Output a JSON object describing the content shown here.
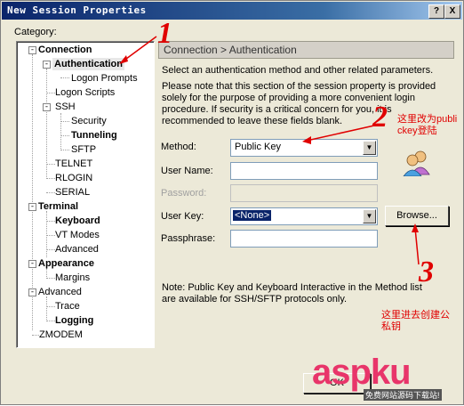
{
  "window": {
    "title": "New Session Properties",
    "help_btn": "?",
    "close_btn": "X"
  },
  "category_label": "Category:",
  "tree": {
    "connection": "Connection",
    "authentication": "Authentication",
    "logon_prompts": "Logon Prompts",
    "logon_scripts": "Logon Scripts",
    "ssh": "SSH",
    "security": "Security",
    "tunneling": "Tunneling",
    "sftp": "SFTP",
    "telnet": "TELNET",
    "rlogin": "RLOGIN",
    "serial": "SERIAL",
    "terminal": "Terminal",
    "keyboard": "Keyboard",
    "vt_modes": "VT Modes",
    "advanced_term": "Advanced",
    "appearance": "Appearance",
    "margins": "Margins",
    "advanced": "Advanced",
    "trace": "Trace",
    "logging": "Logging",
    "zmodem": "ZMODEM",
    "expand_minus": "-"
  },
  "panel": {
    "header": "Connection > Authentication",
    "intro": "Select an authentication method and other related parameters.",
    "note": "Please note that this section of the session property is provided solely for the purpose of providing a more convenient login procedure. If security is a critical concern for you, it is recommended to leave these fields blank.",
    "method_label": "Method:",
    "method_value": "Public Key",
    "username_label": "User Name:",
    "password_label": "Password:",
    "userkey_label": "User Key:",
    "userkey_value": "<None>",
    "browse_btn": "Browse...",
    "passphrase_label": "Passphrase:",
    "footnote": "Note: Public Key and Keyboard Interactive in the Method list are available for SSH/SFTP protocols only."
  },
  "annotations": {
    "n1": "1",
    "n2": "2",
    "n3": "3",
    "note2": "这里改为publickey登陆",
    "note3": "这里进去创建公私钥"
  },
  "watermark": {
    "brand": "aspku",
    "sub": "免费网站源码下载站!"
  },
  "ok_btn": "OK",
  "colors": {
    "title_bar": "#0a246a",
    "annotation": "#e00000",
    "selection": "#0a246a"
  }
}
